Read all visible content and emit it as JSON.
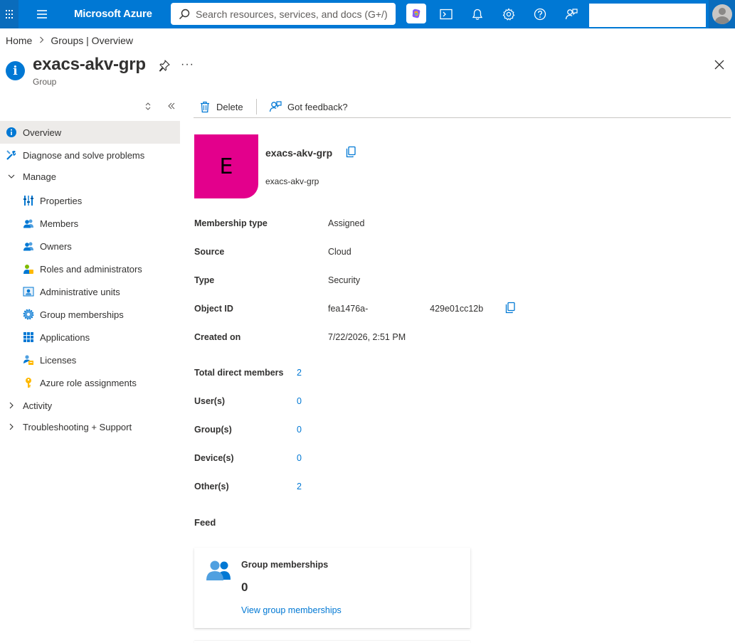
{
  "topbar": {
    "brand": "Microsoft Azure",
    "search_placeholder": "Search resources, services, and docs (G+/)",
    "icons": [
      "waffle-icon",
      "hamburger-icon",
      "copilot-icon",
      "cloud-shell-icon",
      "notifications-icon",
      "settings-icon",
      "help-icon",
      "feedback-icon",
      "account-avatar"
    ]
  },
  "breadcrumb": {
    "items": [
      "Home",
      "Groups | Overview"
    ],
    "separator": ">"
  },
  "header": {
    "title": "exacs-akv-grp",
    "subtitle": "Group",
    "more": "···"
  },
  "sidebar": {
    "items": [
      {
        "label": "Overview",
        "icon": "info-icon"
      },
      {
        "label": "Diagnose and solve problems",
        "icon": "wrench-icon"
      },
      {
        "label": "Manage",
        "icon": "chevron-down-icon"
      },
      {
        "label": "Properties",
        "icon": "properties-icon"
      },
      {
        "label": "Members",
        "icon": "members-icon"
      },
      {
        "label": "Owners",
        "icon": "owners-icon"
      },
      {
        "label": "Roles and administrators",
        "icon": "roles-icon"
      },
      {
        "label": "Administrative units",
        "icon": "admin-units-icon"
      },
      {
        "label": "Group memberships",
        "icon": "gear-group-icon"
      },
      {
        "label": "Applications",
        "icon": "applications-icon"
      },
      {
        "label": "Licenses",
        "icon": "licenses-icon"
      },
      {
        "label": "Azure role assignments",
        "icon": "key-icon"
      },
      {
        "label": "Activity",
        "icon": "chevron-right-icon"
      },
      {
        "label": "Troubleshooting + Support",
        "icon": "chevron-right-icon"
      }
    ]
  },
  "commands": {
    "delete": "Delete",
    "feedback": "Got feedback?"
  },
  "group": {
    "initial": "E",
    "name": "exacs-akv-grp",
    "sub": "exacs-akv-grp"
  },
  "properties": [
    {
      "label": "Membership type",
      "value": "Assigned"
    },
    {
      "label": "Source",
      "value": "Cloud"
    },
    {
      "label": "Type",
      "value": "Security"
    },
    {
      "label": "Object ID",
      "value": "fea1476a-                         429e01cc12b"
    },
    {
      "label": "Created on",
      "value": "7/22/2026, 2:51 PM"
    }
  ],
  "counts": [
    {
      "label": "Total direct members",
      "value": "2"
    },
    {
      "label": "User(s)",
      "value": "0"
    },
    {
      "label": "Group(s)",
      "value": "0"
    },
    {
      "label": "Device(s)",
      "value": "0"
    },
    {
      "label": "Other(s)",
      "value": "2"
    }
  ],
  "feed": {
    "title": "Feed",
    "card": {
      "title": "Group memberships",
      "value": "0",
      "link": "View group memberships"
    }
  },
  "colors": {
    "azure_blue": "#0078d4",
    "tile": "#e3008c",
    "active_nav": "#edebe9"
  }
}
